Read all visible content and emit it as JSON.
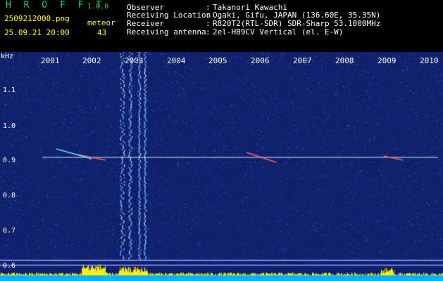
{
  "header": {
    "app_title": "H R O F F T",
    "version": "1.0.0",
    "file_name": "2509212000.png",
    "timestamp": "25.09.21 20:00",
    "meteor_label": "meteor",
    "meteor_count": "43",
    "info": [
      {
        "label": "Observer",
        "value": "Takanori Kawachi"
      },
      {
        "label": "Receiving Location",
        "value": "Ogaki, Gifu, JAPAN (136.60E, 35.35N)"
      },
      {
        "label": "Receiver",
        "value": "R820T2(RTL-SDR) SDR-Sharp 53.1000MHz"
      },
      {
        "label": "Receiving antenna",
        "value": "2el-HB9CV Vertical (el. E-W)"
      }
    ],
    "separator": ":"
  },
  "axis": {
    "unit": "kHz",
    "x_ticks": [
      "2001",
      "2002",
      "2003",
      "2004",
      "2005",
      "2006",
      "2007",
      "2008",
      "2009",
      "2010"
    ],
    "y_ticks": [
      "1.1",
      "1.0",
      "0.9",
      "0.8",
      "0.7",
      "0.6"
    ]
  },
  "colors": {
    "background": "#10206a",
    "noise_low": "#1a3cb8",
    "noise_high": "#4aa0ff",
    "carrier": "#c8e8ff",
    "meteor": "#ff6060",
    "activity_bar": "#ffee00",
    "baseline": "#00b4ff"
  }
}
